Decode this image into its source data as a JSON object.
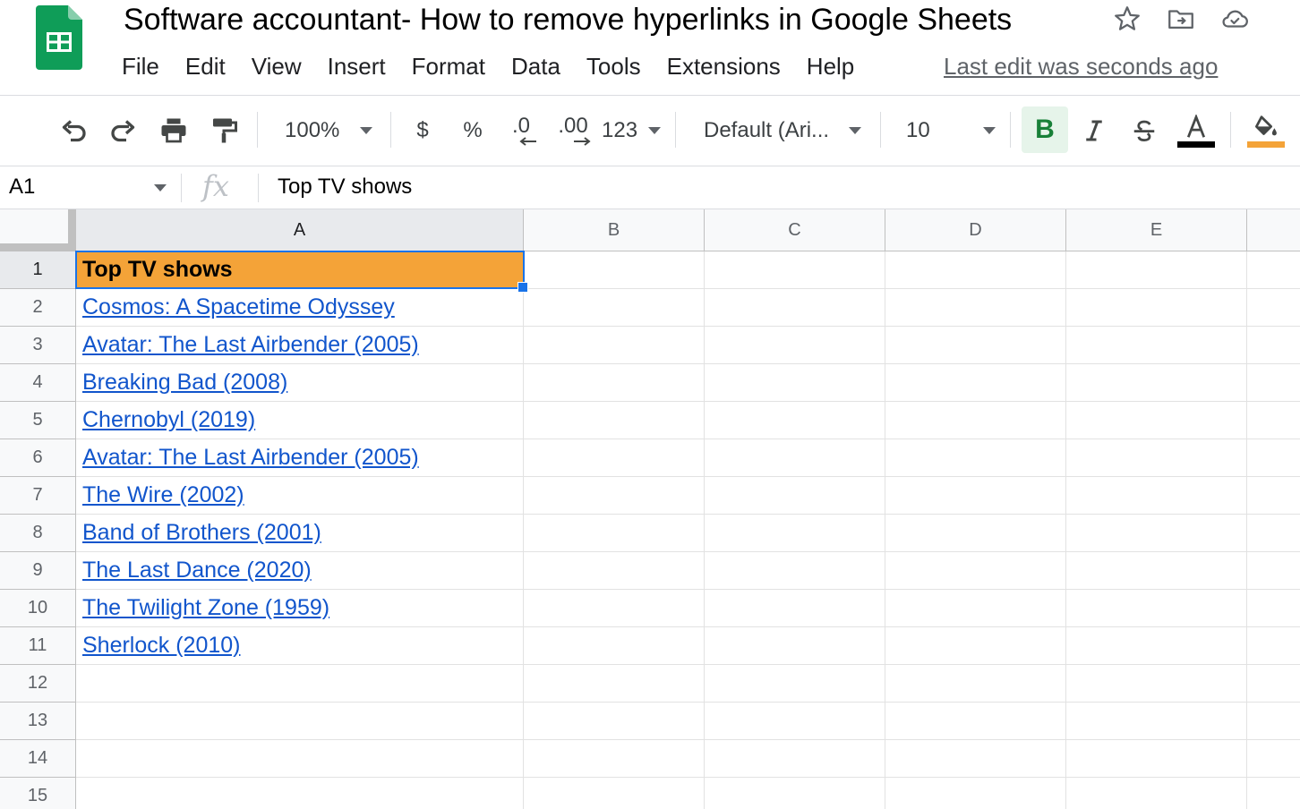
{
  "document": {
    "title": "Software accountant- How to remove hyperlinks in Google Sheets",
    "last_edit": "Last edit was seconds ago"
  },
  "menu": [
    "File",
    "Edit",
    "View",
    "Insert",
    "Format",
    "Data",
    "Tools",
    "Extensions",
    "Help"
  ],
  "toolbar": {
    "zoom": "100%",
    "currency": "$",
    "percent": "%",
    "decrease_decimal": ".0",
    "increase_decimal": ".00",
    "number_format": "123",
    "font": "Default (Ari...",
    "font_size": "10",
    "bold": "B",
    "text_color": "#000000",
    "fill_color": "#f4a338"
  },
  "formula_bar": {
    "cell_ref": "A1",
    "fx": "fx",
    "value": "Top TV shows"
  },
  "grid": {
    "columns": [
      "A",
      "B",
      "C",
      "D",
      "E"
    ],
    "rows": [
      "1",
      "2",
      "3",
      "4",
      "5",
      "6",
      "7",
      "8",
      "9",
      "10",
      "11",
      "12",
      "13",
      "14",
      "15"
    ],
    "cells_col_a": [
      "Top TV shows",
      "Cosmos: A Spacetime Odyssey",
      "Avatar: The Last Airbender (2005)",
      "Breaking Bad (2008)",
      "Chernobyl (2019)",
      "Avatar: The Last Airbender (2005)",
      "The Wire (2002)",
      "Band of Brothers (2001)",
      "The Last Dance (2020)",
      "The Twilight Zone (1959)",
      "Sherlock (2010)",
      "",
      "",
      "",
      ""
    ],
    "selected_cell": "A1",
    "header_fill": "#f4a338",
    "link_color": "#1155cc"
  }
}
